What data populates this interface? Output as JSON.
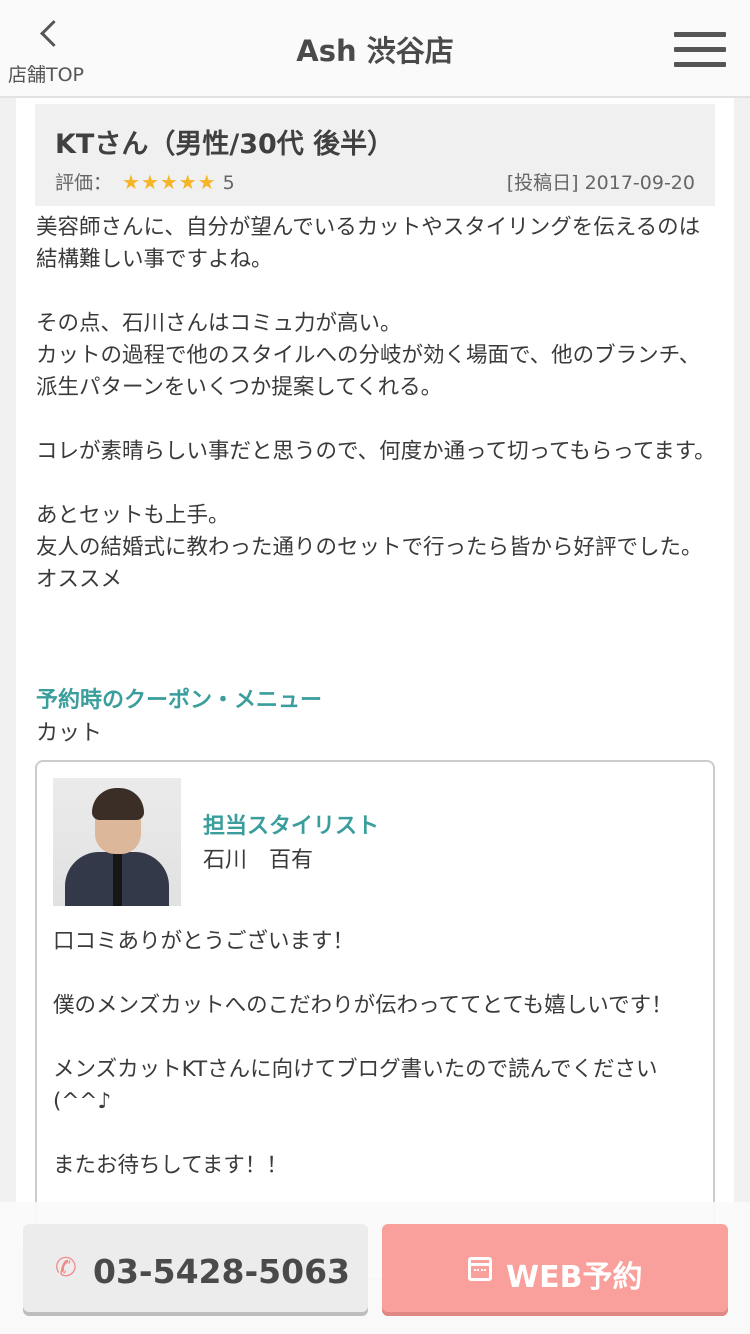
{
  "header": {
    "back_label": "店舗TOP",
    "title": "Ash 渋谷店"
  },
  "review": {
    "author": "KTさん（男性/30代 後半）",
    "rating_label": "評価：",
    "stars": "★★★★★",
    "rating_value": "5",
    "rating_max": 5,
    "date_text": "[投稿日] 2017-09-20",
    "body": "美容師さんに、自分が望んでいるカットやスタイリングを伝えるのは結構難しい事ですよね。\n\nその点、石川さんはコミュ力が高い。\nカットの過程で他のスタイルへの分岐が効く場面で、他のブランチ、派生パターンをいくつか提案してくれる。\n\nコレが素晴らしい事だと思うので、何度か通って切ってもらってます。\n\nあとセットも上手。\n友人の結婚式に教わった通りのセットで行ったら皆から好評でした。\nオススメ",
    "coupon_title": "予約時のクーポン・メニュー",
    "coupon_value": "カット"
  },
  "stylist": {
    "label": "担当スタイリスト",
    "name": "石川　百有",
    "reply": "口コミありがとうございます！\n\n僕のメンズカットへのこだわりが伝わっててとても嬉しいです！\n\nメンズカットKTさんに向けてブログ書いたので読んでください(^^♪\n\nまたお待ちしてます！！"
  },
  "actions": {
    "phone_number": "03-5428-5063",
    "web_reserve_label": "WEB予約"
  },
  "colors": {
    "accent_teal": "#3a9e9c",
    "star_gold": "#f5b526",
    "reserve_pink": "#f9a09d"
  }
}
